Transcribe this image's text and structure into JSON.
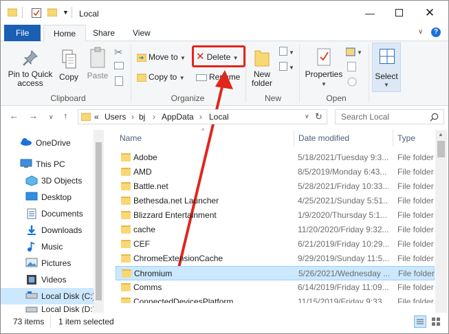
{
  "window": {
    "title": "Local",
    "controls": [
      "minimize-icon",
      "maximize-icon",
      "close-icon"
    ]
  },
  "ribbon_tabs": {
    "file": "File",
    "home": "Home",
    "share": "Share",
    "view": "View"
  },
  "ribbon": {
    "clipboard": {
      "label": "Clipboard",
      "pin": "Pin to Quick",
      "pin2": "access",
      "copy": "Copy",
      "paste": "Paste"
    },
    "organize": {
      "label": "Organize",
      "move_to": "Move to",
      "copy_to": "Copy to",
      "delete": "Delete",
      "rename": "Rename"
    },
    "new": {
      "label": "New",
      "new_folder": "New",
      "new_folder2": "folder"
    },
    "open": {
      "label": "Open",
      "properties": "Properties"
    },
    "select": {
      "label": "Select"
    }
  },
  "address": {
    "prefix": "«",
    "crumbs": [
      "Users",
      "bj",
      "AppData",
      "Local"
    ],
    "search_placeholder": "Search Local"
  },
  "nav_pane": {
    "items": [
      {
        "label": "OneDrive",
        "icon": "cloud-icon"
      },
      {
        "label": "This PC",
        "icon": "computer-icon"
      },
      {
        "label": "3D Objects",
        "icon": "cube-icon"
      },
      {
        "label": "Desktop",
        "icon": "desktop-icon"
      },
      {
        "label": "Documents",
        "icon": "documents-icon"
      },
      {
        "label": "Downloads",
        "icon": "download-icon"
      },
      {
        "label": "Music",
        "icon": "music-icon"
      },
      {
        "label": "Pictures",
        "icon": "pictures-icon"
      },
      {
        "label": "Videos",
        "icon": "videos-icon"
      },
      {
        "label": "Local Disk (C:)",
        "icon": "disk-icon"
      },
      {
        "label": "Local Disk (D:)",
        "icon": "disk-icon"
      }
    ]
  },
  "file_list": {
    "columns": {
      "name": "Name",
      "date": "Date modified",
      "type": "Type"
    },
    "rows": [
      {
        "name": "Adobe",
        "date": "5/18/2021/Tuesday 9:3...",
        "type": "File folder"
      },
      {
        "name": "AMD",
        "date": "8/5/2019/Monday 6:43...",
        "type": "File folder"
      },
      {
        "name": "Battle.net",
        "date": "5/28/2021/Friday 10:33...",
        "type": "File folder"
      },
      {
        "name": "Bethesda.net Launcher",
        "date": "4/25/2021/Sunday 5:51...",
        "type": "File folder"
      },
      {
        "name": "Blizzard Entertainment",
        "date": "1/9/2020/Thursday 5:1...",
        "type": "File folder"
      },
      {
        "name": "cache",
        "date": "11/20/2020/Friday 9:32...",
        "type": "File folder"
      },
      {
        "name": "CEF",
        "date": "6/21/2019/Friday 10:29...",
        "type": "File folder"
      },
      {
        "name": "ChromeExtensionCache",
        "date": "9/29/2019/Sunday 11:5...",
        "type": "File folder"
      },
      {
        "name": "Chromium",
        "date": "5/26/2021/Wednesday ...",
        "type": "File folder"
      },
      {
        "name": "Comms",
        "date": "6/14/2019/Friday 11:09...",
        "type": "File folder"
      },
      {
        "name": "ConnectedDevicesPlatform",
        "date": "11/15/2019/Friday 9:33...",
        "type": "File folder"
      }
    ]
  },
  "status": {
    "count": "73 items",
    "selected": "1 item selected"
  },
  "colors": {
    "file_tab": "#1a5fb4",
    "selection": "#cce8ff",
    "highlight_red": "#e1261c"
  }
}
